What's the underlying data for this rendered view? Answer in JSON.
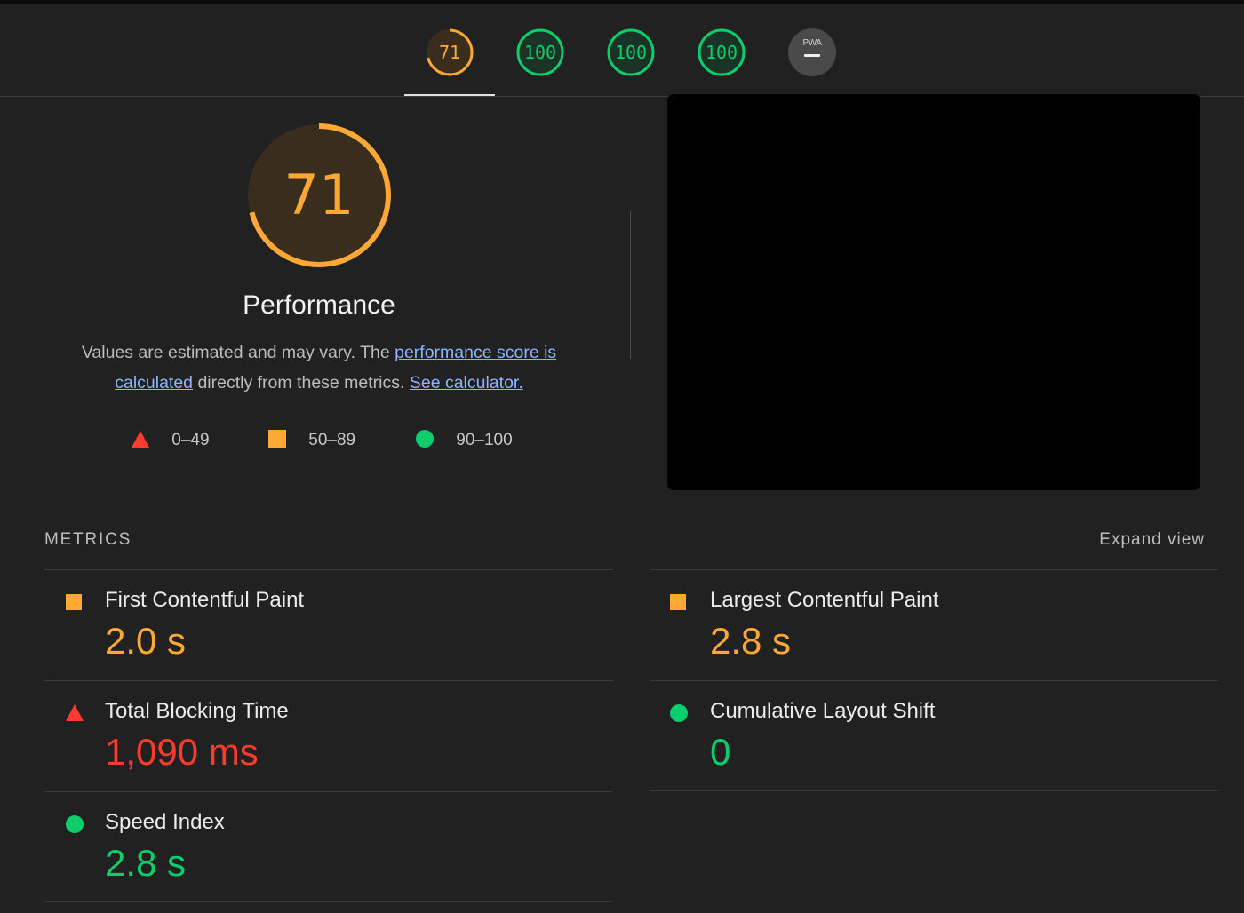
{
  "tabs": [
    {
      "label": "71",
      "score": 71,
      "status": "average",
      "color": "#ffa836",
      "selected": true
    },
    {
      "label": "100",
      "score": 100,
      "status": "pass",
      "color": "#0cce6b",
      "selected": false
    },
    {
      "label": "100",
      "score": 100,
      "status": "pass",
      "color": "#0cce6b",
      "selected": false
    },
    {
      "label": "100",
      "score": 100,
      "status": "pass",
      "color": "#0cce6b",
      "selected": false
    },
    {
      "label": "PWA",
      "score": null,
      "status": "not-applicable",
      "icon": "pwa-dash-icon",
      "selected": false
    }
  ],
  "performance": {
    "score": "71",
    "score_value": 71,
    "color": "#ffa836",
    "title": "Performance",
    "desc_prefix": "Values are estimated and may vary. The ",
    "desc_link1": "performance score is calculated",
    "desc_middle": " directly from these metrics. ",
    "desc_link2": "See calculator."
  },
  "legend": [
    {
      "shape": "triangle",
      "label": "0–49",
      "color": "#ff3b30"
    },
    {
      "shape": "square",
      "label": "50–89",
      "color": "#ffa836"
    },
    {
      "shape": "circle",
      "label": "90–100",
      "color": "#0cce6b"
    }
  ],
  "metrics": {
    "heading": "METRICS",
    "expand_label": "Expand view",
    "items": [
      {
        "name": "First Contentful Paint",
        "value": "2.0 s",
        "status": "average"
      },
      {
        "name": "Largest Contentful Paint",
        "value": "2.8 s",
        "status": "average"
      },
      {
        "name": "Total Blocking Time",
        "value": "1,090 ms",
        "status": "fail"
      },
      {
        "name": "Cumulative Layout Shift",
        "value": "0",
        "status": "pass"
      },
      {
        "name": "Speed Index",
        "value": "2.8 s",
        "status": "pass"
      }
    ]
  }
}
